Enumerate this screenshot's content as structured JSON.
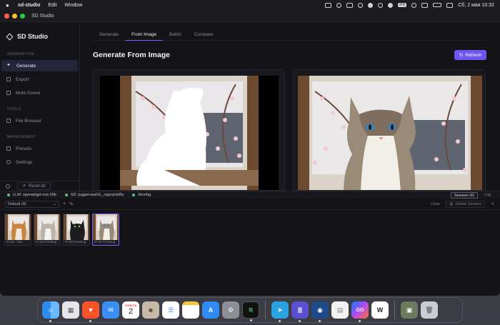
{
  "menubar": {
    "app_name": "sd-studio",
    "menus": [
      "Edit",
      "Window"
    ],
    "datetime": "Сб, 2 мая  10:32",
    "status_icons": [
      "display-icon",
      "layers-icon",
      "stack-icon",
      "shield-icon",
      "navigator-icon",
      "bluetooth-icon",
      "dropbox-icon",
      "pdf-icon",
      "wifi-icon",
      "screen-icon",
      "battery-icon",
      "control-center-icon"
    ]
  },
  "window": {
    "title": "SD Studio"
  },
  "sidebar": {
    "brand": "SD Studio",
    "sections": [
      {
        "label": "GENERATION",
        "items": [
          {
            "label": "Generate",
            "icon": "sparkle-icon",
            "active": true
          },
          {
            "label": "Export",
            "icon": "export-icon",
            "active": false
          },
          {
            "label": "Multi-Scene",
            "icon": "grid-icon",
            "active": false
          }
        ]
      },
      {
        "label": "TOOLS",
        "items": [
          {
            "label": "File Browser",
            "icon": "folder-icon",
            "active": false
          }
        ]
      },
      {
        "label": "MANAGEMENT",
        "items": [
          {
            "label": "Presets",
            "icon": "presets-icon",
            "active": false
          },
          {
            "label": "Settings",
            "icon": "gear-icon",
            "active": false
          }
        ]
      }
    ],
    "reset_label": "Reset All"
  },
  "main": {
    "tabs": [
      {
        "label": "Generate",
        "active": false
      },
      {
        "label": "From Image",
        "active": true
      },
      {
        "label": "Batch",
        "active": false
      },
      {
        "label": "Compare",
        "active": false
      }
    ],
    "title": "Generate From Image",
    "refresh_label": "Refresh"
  },
  "statusbar": {
    "llm": "LLM: openai/gpt-oss-20b",
    "sd": "SD: juggernautXL_ragnarokBy",
    "rembg": "Rembg",
    "session_tab": "Session (4)",
    "log_tab": "Log",
    "status_color": "#4ec57a"
  },
  "session": {
    "selected": "Default (4)",
    "clear_label": "Clear",
    "delete_label": "Delete Session",
    "thumbnails": [
      {
        "caption": "07:26 · Gen",
        "selected": false
      },
      {
        "caption": "07:28 FromImg",
        "selected": false
      },
      {
        "caption": "07:30 FromImg",
        "selected": false
      },
      {
        "caption": "07:32 FromImg",
        "selected": true
      }
    ]
  },
  "dock": {
    "calendar_month": "СУББОТА",
    "calendar_day": "2",
    "terminal_text": "$|",
    "goland_text": "GO",
    "w_text": "W",
    "apps": [
      "finder-icon",
      "launchpad-icon",
      "brave-icon",
      "mail-icon",
      "calendar-icon",
      "contacts-icon",
      "reminders-icon",
      "notes-icon",
      "app-store-icon",
      "system-settings-icon",
      "terminal-icon",
      "telegram-icon",
      "database-icon",
      "disk-icon",
      "sheets-icon",
      "goland-icon",
      "w-icon",
      "downloads-icon",
      "trash-icon"
    ]
  },
  "colors": {
    "accent": "#7b61ff",
    "button": "#6e56f0",
    "background": "#141418"
  }
}
